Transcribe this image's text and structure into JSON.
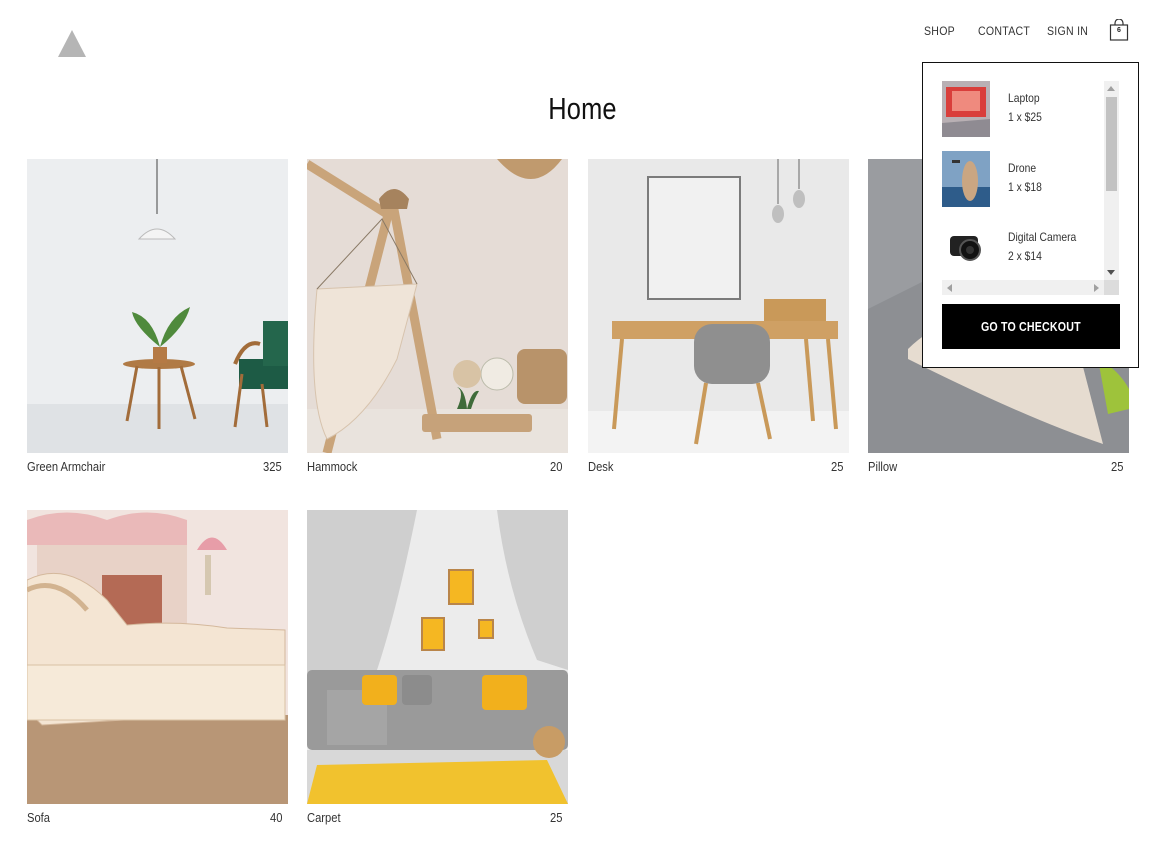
{
  "nav": {
    "shop": "SHOP",
    "contact": "CONTACT",
    "sign_in": "SIGN IN",
    "cart_count": "6"
  },
  "page": {
    "title": "Home"
  },
  "products": [
    {
      "name": "Green Armchair",
      "price": "325"
    },
    {
      "name": "Hammock",
      "price": "20"
    },
    {
      "name": "Desk",
      "price": "25"
    },
    {
      "name": "Pillow",
      "price": "25"
    },
    {
      "name": "Sofa",
      "price": "40"
    },
    {
      "name": "Carpet",
      "price": "25"
    }
  ],
  "cart": {
    "items": [
      {
        "name": "Laptop",
        "qty": "1 x $25"
      },
      {
        "name": "Drone",
        "qty": "1 x $18"
      },
      {
        "name": "Digital Camera",
        "qty": "2 x $14"
      }
    ],
    "checkout_label": "GO TO CHECKOUT"
  },
  "colors": {
    "logo": "#b5b5b5",
    "checkout_bg": "#000000",
    "accent_yellow": "#f5c02a"
  }
}
